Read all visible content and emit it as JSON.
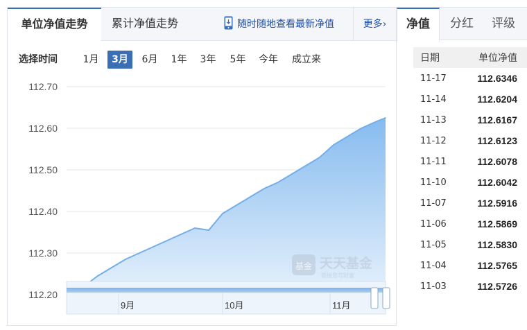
{
  "left_tabs": {
    "unit_nav": "单位净值走势",
    "cumulative_nav": "累计净值走势",
    "mobile_link": "随时随地查看最新净值",
    "more": "更多",
    "more_arrow": "›"
  },
  "time_range": {
    "label": "选择时间",
    "options": [
      "1月",
      "3月",
      "6月",
      "1年",
      "3年",
      "5年",
      "今年",
      "成立来"
    ],
    "selected": "3月"
  },
  "watermark": {
    "logo_text": "基金",
    "brand": "天天基金",
    "slogan": "链接您与财富"
  },
  "colors": {
    "accent": "#3a6fb5",
    "line": "#74aee6",
    "area_top": "#86bbef",
    "area_bottom": "#e6f1fc",
    "grid": "#e6e6e6"
  },
  "chart_data": {
    "type": "area",
    "title": "",
    "xlabel": "",
    "ylabel": "",
    "ylim": [
      112.2,
      112.7
    ],
    "yticks": [
      "112.70",
      "112.60",
      "112.50",
      "112.40",
      "112.30",
      "112.20"
    ],
    "xtick_labels": [
      {
        "label": "9月",
        "date": "2025-09-01"
      },
      {
        "label": "10月",
        "date": "2025-10-01"
      },
      {
        "label": "11月",
        "date": "2025-11-01"
      }
    ],
    "x_start": "2025-08-17",
    "x_end": "2025-11-17",
    "grid": true,
    "series": [
      {
        "x": [
          "2025-08-18",
          "2025-08-22",
          "2025-08-26",
          "2025-08-30",
          "2025-09-03",
          "2025-09-07",
          "2025-09-11",
          "2025-09-15",
          "2025-09-19",
          "2025-09-23",
          "2025-09-27",
          "2025-10-01",
          "2025-10-05",
          "2025-10-09",
          "2025-10-13",
          "2025-10-17",
          "2025-10-21",
          "2025-10-25",
          "2025-10-29",
          "2025-11-02",
          "2025-11-06",
          "2025-11-10",
          "2025-11-14",
          "2025-11-17"
        ],
        "y": [
          112.21,
          112.22,
          112.245,
          112.265,
          112.285,
          112.3,
          112.315,
          112.33,
          112.345,
          112.36,
          112.355,
          112.395,
          112.415,
          112.435,
          112.455,
          112.47,
          112.49,
          112.51,
          112.53,
          112.56,
          112.58,
          112.6,
          112.615,
          112.625
        ]
      }
    ]
  },
  "right_tabs": {
    "nav": "净值",
    "dividend": "分红",
    "rating": "评级"
  },
  "nav_table": {
    "headers": [
      "日期",
      "单位净值"
    ],
    "rows": [
      {
        "date": "11-17",
        "value": "112.6346"
      },
      {
        "date": "11-14",
        "value": "112.6204"
      },
      {
        "date": "11-13",
        "value": "112.6167"
      },
      {
        "date": "11-12",
        "value": "112.6123"
      },
      {
        "date": "11-11",
        "value": "112.6078"
      },
      {
        "date": "11-10",
        "value": "112.6042"
      },
      {
        "date": "11-07",
        "value": "112.5916"
      },
      {
        "date": "11-06",
        "value": "112.5869"
      },
      {
        "date": "11-05",
        "value": "112.5830"
      },
      {
        "date": "11-04",
        "value": "112.5765"
      },
      {
        "date": "11-03",
        "value": "112.5726"
      }
    ]
  }
}
